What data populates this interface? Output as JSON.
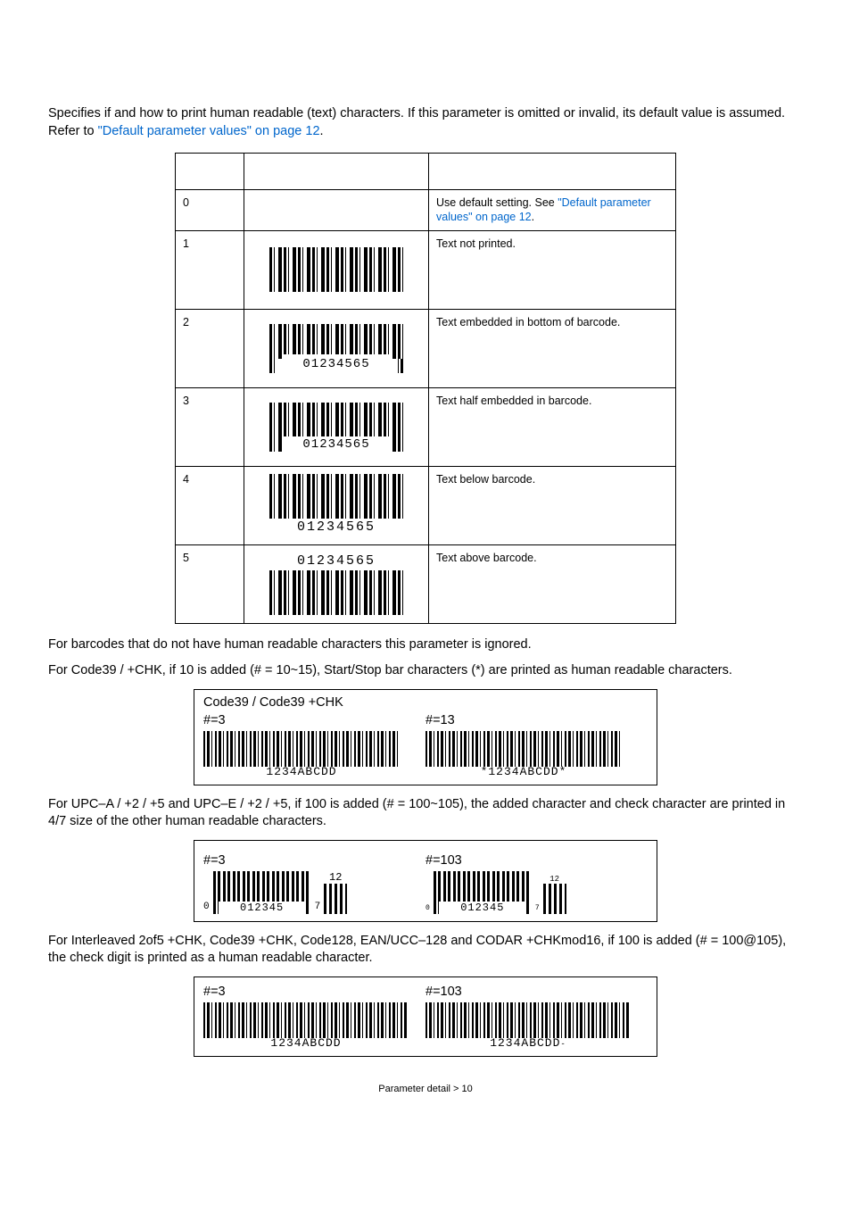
{
  "intro": {
    "text": "Specifies if and how to print human readable (text) characters. If this parameter is omitted or invalid, its default value is assumed. Refer to ",
    "link": "\"Default parameter values\" on page 12",
    "suffix": "."
  },
  "table": {
    "rows": [
      {
        "val": "0",
        "bartxt": "",
        "desc_pre": "Use default setting. See ",
        "desc_link": "\"Default parameter values\" on page 12",
        "desc_post": "."
      },
      {
        "val": "1",
        "bartxt": "",
        "desc": "Text not printed."
      },
      {
        "val": "2",
        "bartxt": "01234565",
        "desc": "Text embedded in bottom of barcode."
      },
      {
        "val": "3",
        "bartxt": "01234565",
        "desc": "Text half embedded in barcode."
      },
      {
        "val": "4",
        "bartxt": "01234565",
        "desc": "Text below barcode."
      },
      {
        "val": "5",
        "bartxt": "01234565",
        "desc": "Text above barcode."
      }
    ]
  },
  "para1": "For barcodes that do not have human readable characters this parameter is ignored.",
  "para2": "For Code39 / +CHK, if 10 is added (# = 10~15), Start/Stop bar characters (*) are printed as human readable characters.",
  "ex1": {
    "title": "Code39 / Code39 +CHK",
    "left_label": "#=3",
    "left_txt": "1234ABCDD",
    "right_label": "#=13",
    "right_txt": "*1234ABCDD*"
  },
  "para3": "For UPC–A / +2 / +5 and UPC–E / +2 / +5, if 100 is added (# = 100~105), the added character and check character are printed in 4/7 size of the other human readable characters.",
  "ex2": {
    "left_label": "#=3",
    "right_label": "#=103",
    "lead": "0",
    "digits": "012345",
    "trail": "7",
    "sup": "12"
  },
  "para4": "For Interleaved 2of5 +CHK, Code39 +CHK, Code128, EAN/UCC–128 and CODAR +CHKmod16, if 100 is added (# = 100@105), the check digit is printed as a human readable character.",
  "ex3": {
    "left_label": "#=3",
    "left_txt": "1234ABCDD",
    "right_label": "#=103",
    "right_txt": "1234ABCDD",
    "right_chk": "-"
  },
  "footer": "Parameter detail > 10"
}
